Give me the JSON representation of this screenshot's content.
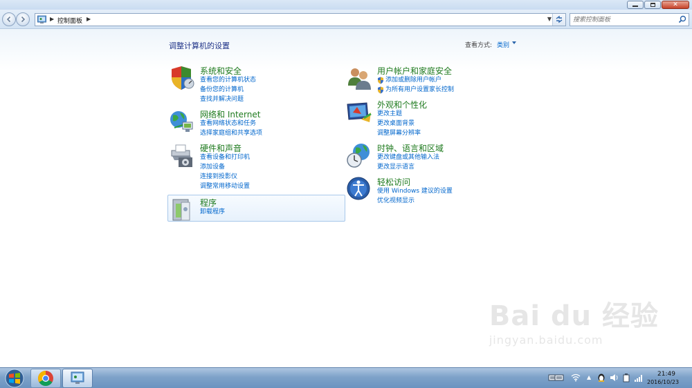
{
  "window": {
    "minimize_glyph": "—",
    "maximize_glyph": "❐",
    "close_glyph": "✕"
  },
  "navbar": {
    "back_icon": "back-arrow-icon",
    "forward_icon": "forward-arrow-icon",
    "breadcrumb": "控制面板",
    "search_placeholder": "搜索控制面板"
  },
  "header": {
    "title": "调整计算机的设置",
    "view_by_label": "查看方式:",
    "view_by_value": "类别"
  },
  "categories": {
    "system": {
      "title": "系统和安全",
      "links": [
        "查看您的计算机状态",
        "备份您的计算机",
        "查找并解决问题"
      ]
    },
    "network": {
      "title": "网络和 Internet",
      "links": [
        "查看网络状态和任务",
        "选择家庭组和共享选项"
      ]
    },
    "hardware": {
      "title": "硬件和声音",
      "links": [
        "查看设备和打印机",
        "添加设备",
        "连接到投影仪",
        "调整常用移动设置"
      ]
    },
    "programs": {
      "title": "程序",
      "links": [
        "卸载程序"
      ]
    },
    "users": {
      "title": "用户帐户和家庭安全",
      "links": [
        "添加或删除用户帐户",
        "为所有用户设置家长控制"
      ]
    },
    "appearance": {
      "title": "外观和个性化",
      "links": [
        "更改主题",
        "更改桌面背景",
        "调整屏幕分辨率"
      ]
    },
    "clock": {
      "title": "时钟、语言和区域",
      "links": [
        "更改键盘或其他输入法",
        "更改显示语言"
      ]
    },
    "ease": {
      "title": "轻松访问",
      "links": [
        "使用 Windows 建议的设置",
        "优化视频显示"
      ]
    }
  },
  "watermark": {
    "main": "Bai du 经验",
    "sub": "jingyan.baidu.com"
  },
  "taskbar": {
    "time": "21:49",
    "date": "2016/10/23"
  },
  "colors": {
    "link": "#0066cc",
    "category_title": "#1e7a1e",
    "page_title": "#1e3287"
  }
}
